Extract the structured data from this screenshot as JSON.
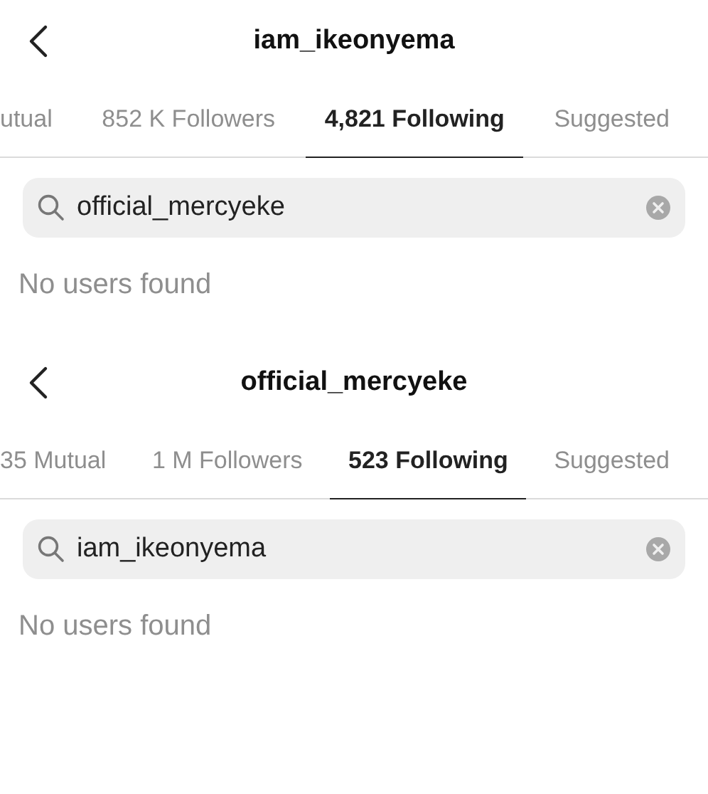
{
  "screens": [
    {
      "title": "iam_ikeonyema",
      "tabs": [
        {
          "label": "utual",
          "selected": false
        },
        {
          "label": "852 K Followers",
          "selected": false
        },
        {
          "label": "4,821 Following",
          "selected": true
        },
        {
          "label": "Suggested",
          "selected": false
        }
      ],
      "search": {
        "value": "official_mercyeke"
      },
      "message": "No users found"
    },
    {
      "title": "official_mercyeke",
      "tabs": [
        {
          "label": "35 Mutual",
          "selected": false
        },
        {
          "label": "1 M Followers",
          "selected": false
        },
        {
          "label": "523 Following",
          "selected": true
        },
        {
          "label": "Suggested",
          "selected": false
        }
      ],
      "search": {
        "value": "iam_ikeonyema"
      },
      "message": "No users found"
    }
  ]
}
